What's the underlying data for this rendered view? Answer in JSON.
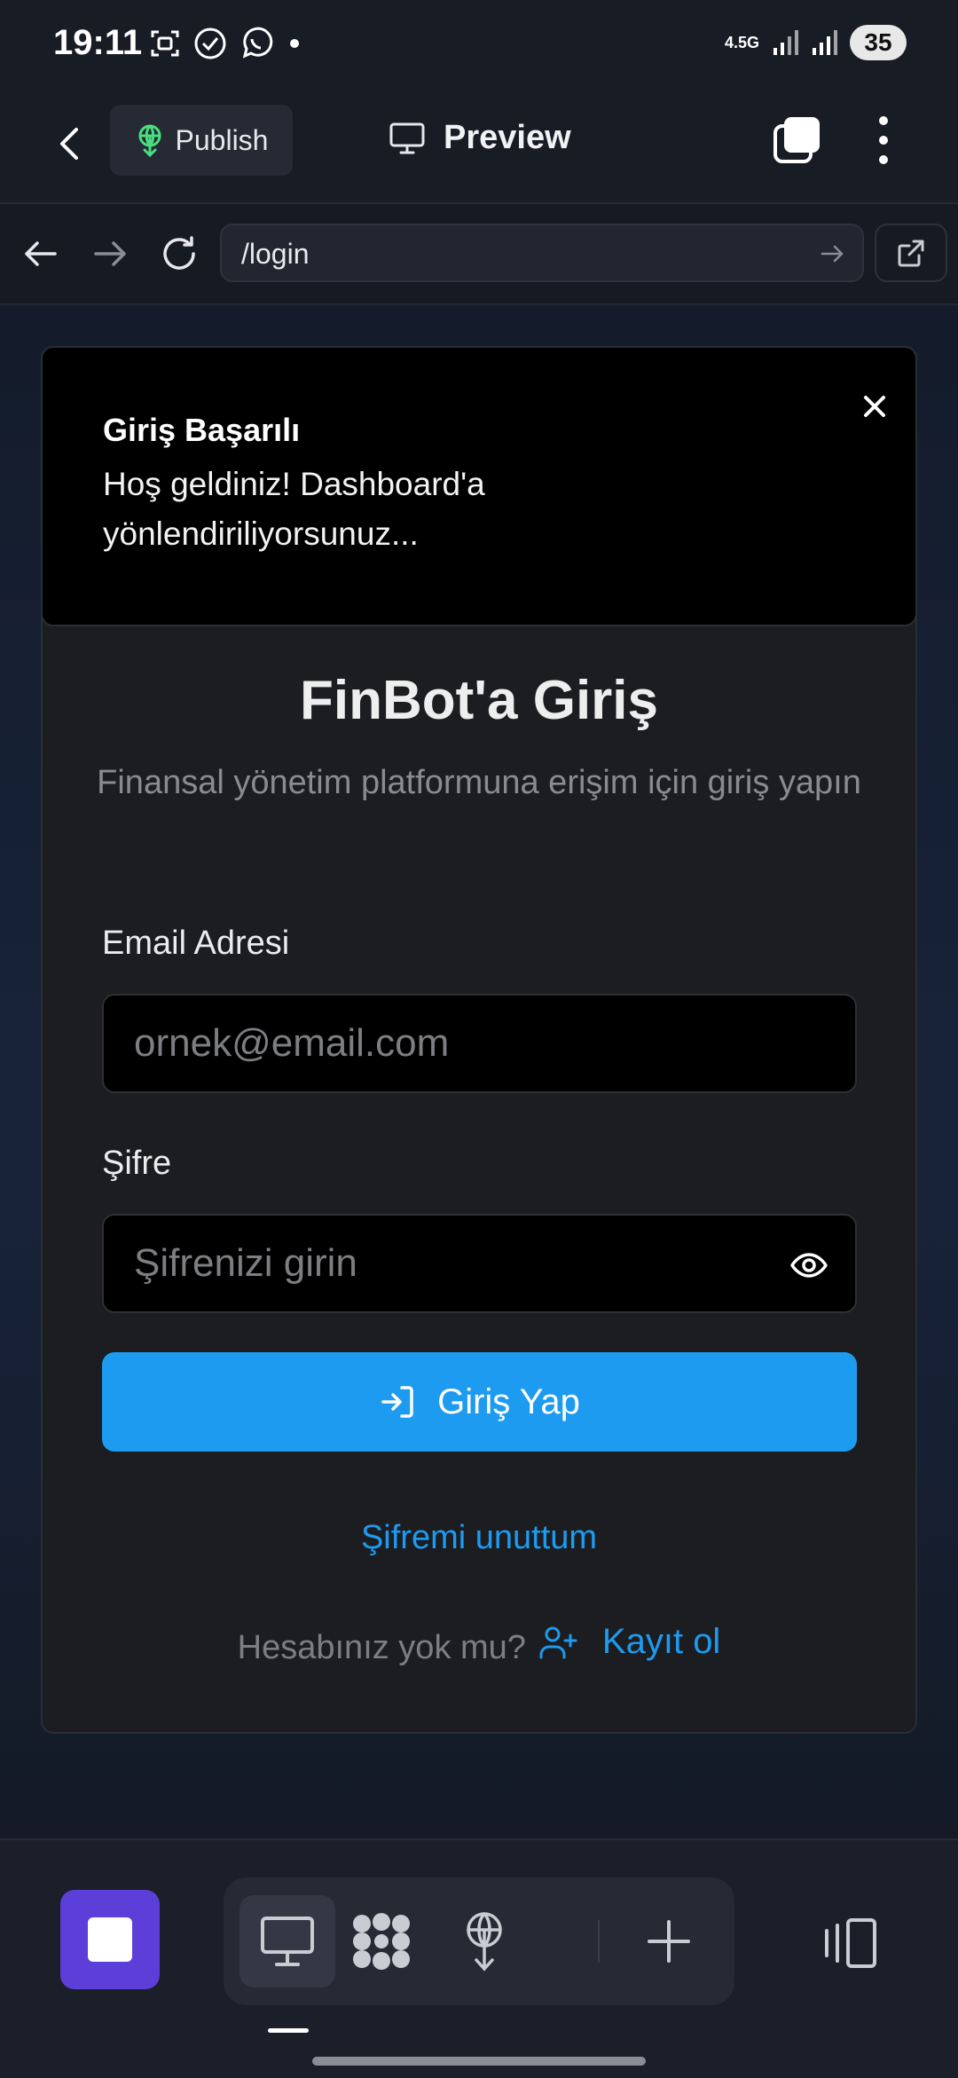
{
  "status_bar": {
    "time": "19:11",
    "network": "4.5G",
    "battery": "35"
  },
  "app_bar": {
    "publish_label": "Publish",
    "preview_label": "Preview"
  },
  "browser": {
    "url": "/login"
  },
  "toast": {
    "title": "Giriş Başarılı",
    "message": "Hoş geldiniz! Dashboard'a yönlendiriliyorsunuz..."
  },
  "login": {
    "title": "FinBot'a Giriş",
    "subtitle": "Finansal yönetim platformuna erişim için giriş yapın",
    "email_label": "Email Adresi",
    "email_placeholder": "ornek@email.com",
    "password_label": "Şifre",
    "password_placeholder": "Şifrenizi girin",
    "submit_label": "Giriş Yap",
    "forgot_label": "Şifremi unuttum",
    "no_account_text": "Hesabınız yok mu?",
    "signup_label": "Kayıt ol"
  },
  "colors": {
    "accent": "#1d9bf0",
    "stop_button": "#5b3fd8",
    "publish_icon": "#4ade80"
  }
}
